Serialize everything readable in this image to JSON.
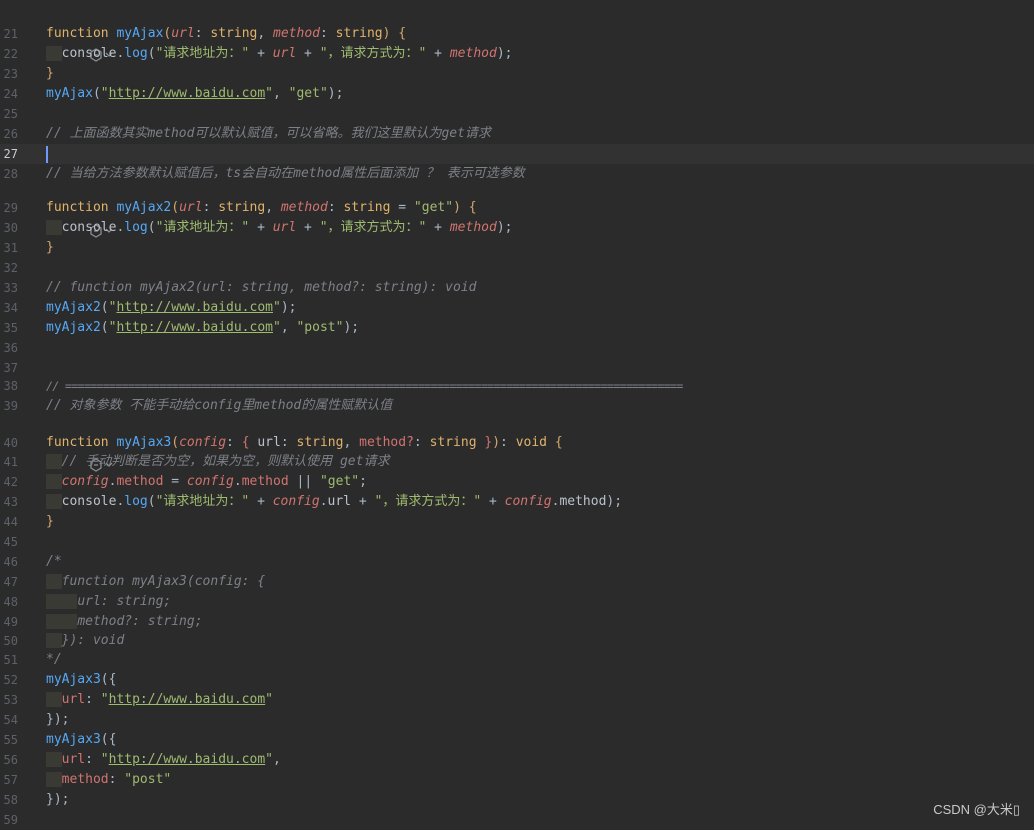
{
  "editor": {
    "current_line": "27",
    "lines": [
      {
        "n": "21"
      },
      {
        "n": "22"
      },
      {
        "n": "23"
      },
      {
        "n": "24"
      },
      {
        "n": "25"
      },
      {
        "n": "26"
      },
      {
        "n": "27"
      },
      {
        "n": "28"
      },
      {
        "n": "29"
      },
      {
        "n": "30"
      },
      {
        "n": "31"
      },
      {
        "n": "32"
      },
      {
        "n": "33"
      },
      {
        "n": "34"
      },
      {
        "n": "35"
      },
      {
        "n": "36"
      },
      {
        "n": "37"
      },
      {
        "n": "38"
      },
      {
        "n": "39"
      },
      {
        "n": "40"
      },
      {
        "n": "41"
      },
      {
        "n": "42"
      },
      {
        "n": "43"
      },
      {
        "n": "44"
      },
      {
        "n": "45"
      },
      {
        "n": "46"
      },
      {
        "n": "47"
      },
      {
        "n": "48"
      },
      {
        "n": "49"
      },
      {
        "n": "50"
      },
      {
        "n": "51"
      },
      {
        "n": "52"
      },
      {
        "n": "53"
      },
      {
        "n": "54"
      },
      {
        "n": "55"
      },
      {
        "n": "56"
      },
      {
        "n": "57"
      },
      {
        "n": "58"
      },
      {
        "n": "59"
      }
    ]
  },
  "code": {
    "l21_kw": "function",
    "l21_fn": "myAjax",
    "l21_p1": "url",
    "l21_t1": "string",
    "l21_p2": "method",
    "l21_t2": "string",
    "l22_obj": "console",
    "l22_meth": "log",
    "l22_s1": "\"请求地址为：\"",
    "l22_v1": "url",
    "l22_s2": "\"，请求方式为：\"",
    "l22_v2": "method",
    "l24_fn": "myAjax",
    "l24_url": "http://www.baidu.com",
    "l24_s": "\"get\"",
    "l26_cmt": "// 上面函数其实method可以默认赋值，可以省略。我们这里默认为get请求",
    "l28_cmt": "// 当给方法参数默认赋值后，ts会自动在method属性后面添加 ？ 表示可选参数",
    "l29_kw": "function",
    "l29_fn": "myAjax2",
    "l29_p1": "url",
    "l29_t1": "string",
    "l29_p2": "method",
    "l29_t2": "string",
    "l29_s": "\"get\"",
    "l30_obj": "console",
    "l30_meth": "log",
    "l30_s1": "\"请求地址为：\"",
    "l30_v1": "url",
    "l30_s2": "\"，请求方式为：\"",
    "l30_v2": "method",
    "l33_cmt": "// function myAjax2(url: string, method?: string): void",
    "l34_fn": "myAjax2",
    "l34_url": "http://www.baidu.com",
    "l35_fn": "myAjax2",
    "l35_url": "http://www.baidu.com",
    "l35_s": "\"post\"",
    "l38_cmt": "// ==================================================================================================",
    "l39_cmt": "// 对象参数 不能手动给config里method的属性赋默认值",
    "l40_kw": "function",
    "l40_fn": "myAjax3",
    "l40_p": "config",
    "l40_k1": "url",
    "l40_t1": "string",
    "l40_k2": "method?",
    "l40_t2": "string",
    "l40_ret": "void",
    "l41_cmt": "// 手动判断是否为空，如果为空，则默认使用 get请求",
    "l42_p1": "config",
    "l42_m1": "method",
    "l42_p2": "config",
    "l42_m2": "method",
    "l42_s": "\"get\"",
    "l43_obj": "console",
    "l43_meth": "log",
    "l43_s1": "\"请求地址为：\"",
    "l43_p1": "config",
    "l43_k1": "url",
    "l43_s2": "\"，请求方式为：\"",
    "l43_p2": "config",
    "l43_k2": "method",
    "l46_cmt": "/*",
    "l47_cmt": "function myAjax3(config: {",
    "l48_cmt": "url: string;",
    "l49_cmt": "method?: string;",
    "l50_cmt": "}): void",
    "l51_cmt": "*/",
    "l52_fn": "myAjax3",
    "l53_k": "url",
    "l53_url": "http://www.baidu.com",
    "l55_fn": "myAjax3",
    "l56_k": "url",
    "l56_url": "http://www.baidu.com",
    "l57_k": "method",
    "l57_s": "\"post\""
  },
  "watermark": "CSDN @大米▯"
}
